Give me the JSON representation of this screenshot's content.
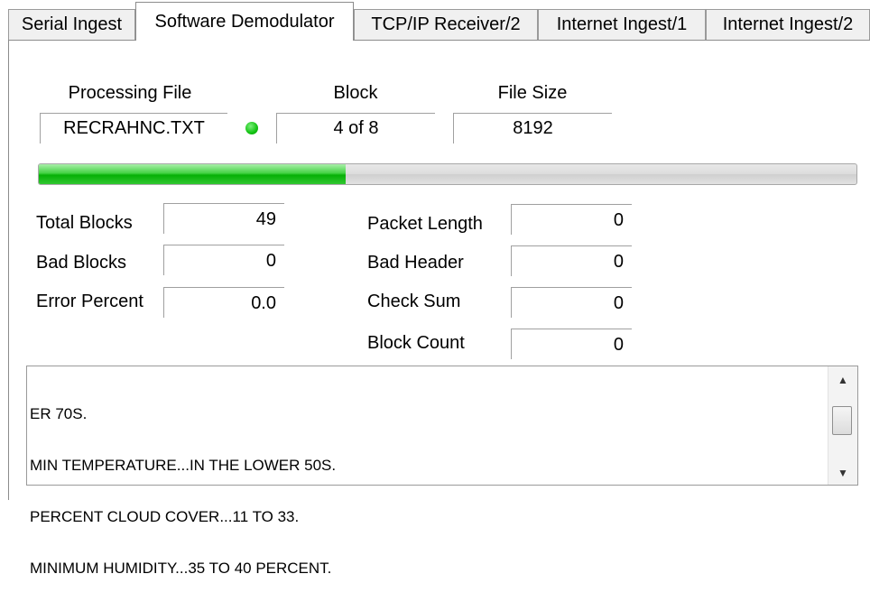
{
  "tabs": [
    {
      "label": "Serial Ingest",
      "active": false
    },
    {
      "label": "Software Demodulator",
      "active": true
    },
    {
      "label": "TCP/IP Receiver/2",
      "active": false
    },
    {
      "label": "Internet Ingest/1",
      "active": false
    },
    {
      "label": "Internet Ingest/2",
      "active": false
    }
  ],
  "processing": {
    "file_header": "Processing File",
    "file_value": "RECRAHNC.TXT",
    "block_header": "Block",
    "block_value": "4 of 8",
    "size_header": "File Size",
    "size_value": "8192",
    "status_color": "#12c212"
  },
  "progress": {
    "fraction": 0.375,
    "fill_color": "#06b006"
  },
  "stats": {
    "total_blocks_label": "Total Blocks",
    "total_blocks_value": "49",
    "bad_blocks_label": "Bad Blocks",
    "bad_blocks_value": "0",
    "error_percent_label": "Error Percent",
    "error_percent_value": "0.0",
    "packet_length_label": "Packet Length",
    "packet_length_value": "0",
    "bad_header_label": "Bad Header",
    "bad_header_value": "0",
    "check_sum_label": "Check Sum",
    "check_sum_value": "0",
    "block_count_label": "Block Count",
    "block_count_value": "0"
  },
  "log": {
    "lines": [
      "ER 70S.",
      "MIN TEMPERATURE...IN THE LOWER 50S.",
      "PERCENT CLOUD COVER...11 TO 33.",
      "MINIMUM HUMIDITY...35 TO 40 PERCENT."
    ],
    "scroll_up_icon": "up-arrow",
    "scroll_down_icon": "down-arrow"
  }
}
